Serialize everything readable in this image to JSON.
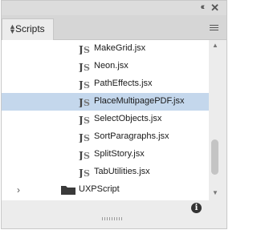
{
  "panel": {
    "title_controls": {
      "collapse": "‹‹",
      "close": "✕"
    },
    "tab": {
      "label": "Scripts"
    },
    "items": [
      {
        "name": "MakeGrid.jsx",
        "selected": false
      },
      {
        "name": "Neon.jsx",
        "selected": false
      },
      {
        "name": "PathEffects.jsx",
        "selected": false
      },
      {
        "name": "PlaceMultipagePDF.jsx",
        "selected": true
      },
      {
        "name": "SelectObjects.jsx",
        "selected": false
      },
      {
        "name": "SortParagraphs.jsx",
        "selected": false
      },
      {
        "name": "SplitStory.jsx",
        "selected": false
      },
      {
        "name": "TabUtilities.jsx",
        "selected": false
      }
    ],
    "folder": {
      "name": "UXPScript",
      "expanded": false
    },
    "footer": {
      "info_icon": "i"
    }
  },
  "colors": {
    "selection": "#c4d7ec",
    "panel": "#ececec",
    "list_bg": "#ffffff"
  }
}
